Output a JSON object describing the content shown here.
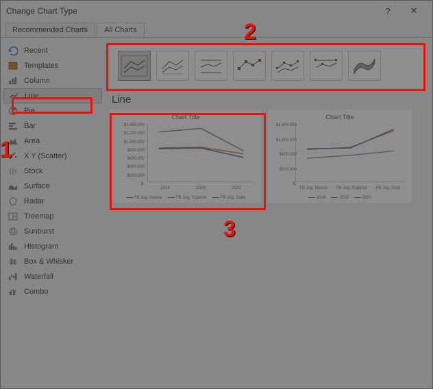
{
  "title": "Change Chart Type",
  "tabs": {
    "recommended": "Recommended Charts",
    "all": "All Charts"
  },
  "sidebar": {
    "items": [
      {
        "label": "Recent"
      },
      {
        "label": "Templates"
      },
      {
        "label": "Column"
      },
      {
        "label": "Line"
      },
      {
        "label": "Pie"
      },
      {
        "label": "Bar"
      },
      {
        "label": "Area"
      },
      {
        "label": "X Y (Scatter)"
      },
      {
        "label": "Stock"
      },
      {
        "label": "Surface"
      },
      {
        "label": "Radar"
      },
      {
        "label": "Treemap"
      },
      {
        "label": "Sunburst"
      },
      {
        "label": "Histogram"
      },
      {
        "label": "Box & Whisker"
      },
      {
        "label": "Waterfall"
      },
      {
        "label": "Combo"
      }
    ]
  },
  "main": {
    "chart_name": "Line",
    "preview1": {
      "title": "Chart Title",
      "yticks": [
        "$1,400,000",
        "$1,200,000",
        "$1,000,000",
        "$800,000",
        "$600,000",
        "$400,000",
        "$200,000",
        "$-"
      ],
      "xticks": [
        "2018",
        "2019",
        "2020"
      ],
      "legend": [
        "FB Jug, Deluxe",
        "FB Jug, Superior",
        "FB Jug, Suite"
      ]
    },
    "preview2": {
      "title": "Chart Title",
      "xticks": [
        "FB Jug, Deluxe",
        "FB Jug, Superior",
        "FB Jug, Suite"
      ],
      "legend": [
        "2018",
        "2019",
        "2020"
      ]
    }
  },
  "annotations": {
    "n1": "1",
    "n2": "2",
    "n3": "3"
  },
  "chart_data": {
    "type": "line",
    "categories": [
      "2018",
      "2019",
      "2020"
    ],
    "series": [
      {
        "name": "FB Jug, Deluxe",
        "values": [
          800000,
          820000,
          600000
        ],
        "color": "#3b74b8"
      },
      {
        "name": "FB Jug, Superior",
        "values": [
          830000,
          840000,
          680000
        ],
        "color": "#d8742a"
      },
      {
        "name": "FB Jug, Suite",
        "values": [
          1200000,
          1300000,
          750000
        ],
        "color": "#8a8a8a"
      }
    ],
    "ylim": [
      0,
      1400000
    ],
    "ylabel": "",
    "xlabel": "",
    "title": "Chart Title"
  }
}
